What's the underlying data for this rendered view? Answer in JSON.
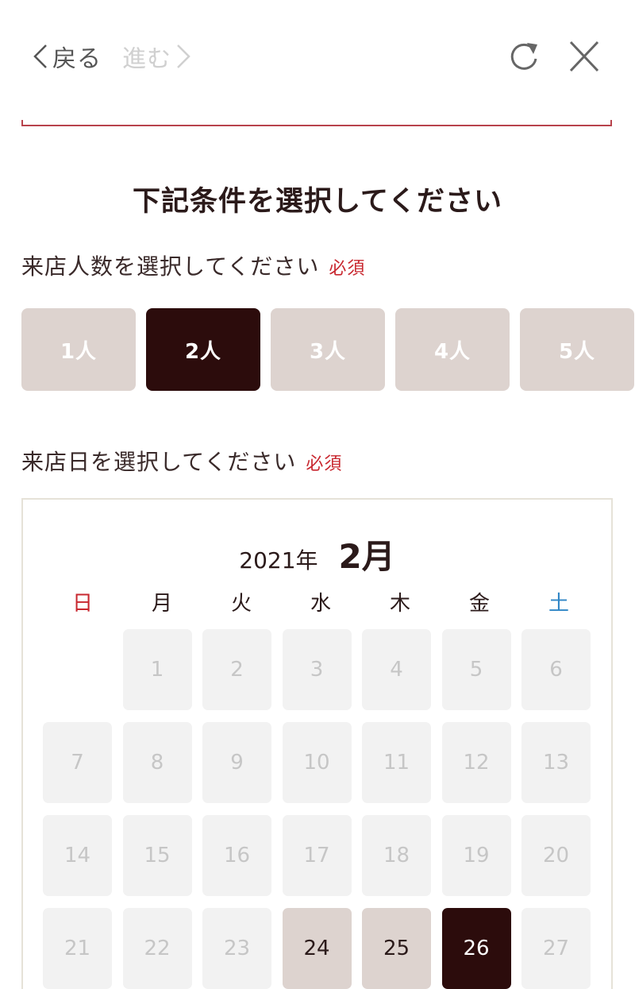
{
  "nav": {
    "back_label": "戻る",
    "forward_label": "進む"
  },
  "page": {
    "title": "下記条件を選択してください"
  },
  "people": {
    "label": "来店人数を選択してください",
    "required": "必須",
    "options": [
      "1人",
      "2人",
      "3人",
      "4人",
      "5人"
    ],
    "selected": "2人"
  },
  "date": {
    "label": "来店日を選択してください",
    "required": "必須"
  },
  "calendar": {
    "year_label": "2021年",
    "month_label": "2月",
    "weekdays": [
      "日",
      "月",
      "火",
      "水",
      "木",
      "金",
      "土"
    ],
    "days": [
      {
        "day": "",
        "state": "empty"
      },
      {
        "day": "1",
        "state": "disabled"
      },
      {
        "day": "2",
        "state": "disabled"
      },
      {
        "day": "3",
        "state": "disabled"
      },
      {
        "day": "4",
        "state": "disabled"
      },
      {
        "day": "5",
        "state": "disabled"
      },
      {
        "day": "6",
        "state": "disabled"
      },
      {
        "day": "7",
        "state": "disabled"
      },
      {
        "day": "8",
        "state": "disabled"
      },
      {
        "day": "9",
        "state": "disabled"
      },
      {
        "day": "10",
        "state": "disabled"
      },
      {
        "day": "11",
        "state": "disabled"
      },
      {
        "day": "12",
        "state": "disabled"
      },
      {
        "day": "13",
        "state": "disabled"
      },
      {
        "day": "14",
        "state": "disabled"
      },
      {
        "day": "15",
        "state": "disabled"
      },
      {
        "day": "16",
        "state": "disabled"
      },
      {
        "day": "17",
        "state": "disabled"
      },
      {
        "day": "18",
        "state": "disabled"
      },
      {
        "day": "19",
        "state": "disabled"
      },
      {
        "day": "20",
        "state": "disabled"
      },
      {
        "day": "21",
        "state": "disabled"
      },
      {
        "day": "22",
        "state": "disabled"
      },
      {
        "day": "23",
        "state": "disabled"
      },
      {
        "day": "24",
        "state": "available"
      },
      {
        "day": "25",
        "state": "available"
      },
      {
        "day": "26",
        "state": "selected"
      },
      {
        "day": "27",
        "state": "disabled"
      }
    ]
  },
  "colors": {
    "accent_dark": "#2c0c0c",
    "available_bg": "#ddd3cf",
    "required_red": "#c8272f",
    "saturday_blue": "#2f86c6",
    "divider_red": "#b8434c"
  }
}
